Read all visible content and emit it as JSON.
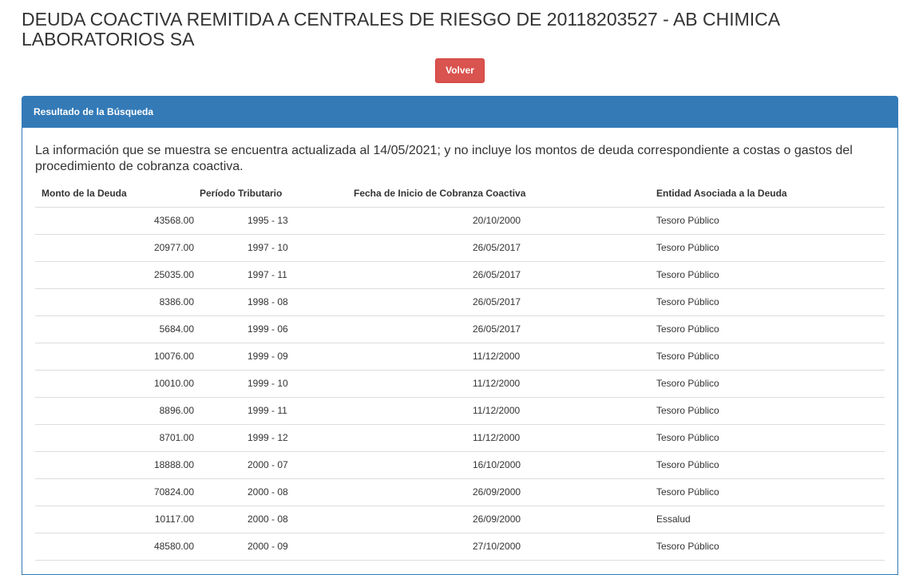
{
  "header": {
    "title": "DEUDA COACTIVA REMITIDA A CENTRALES DE RIESGO DE 20118203527 - AB CHIMICA LABORATORIOS SA",
    "back_label": "Volver"
  },
  "panel": {
    "heading": "Resultado de la Búsqueda",
    "info": "La información que se muestra se encuentra actualizada al 14/05/2021; y no incluye los montos de deuda correspondiente a costas o gastos del procedimiento de cobranza coactiva."
  },
  "table": {
    "columns": [
      "Monto de la Deuda",
      "Período Tributario",
      "Fecha de Inicio de Cobranza Coactiva",
      "Entidad Asociada a la Deuda"
    ],
    "rows": [
      {
        "amount": "43568.00",
        "period": "1995 - 13",
        "date": "20/10/2000",
        "entity": "Tesoro Público"
      },
      {
        "amount": "20977.00",
        "period": "1997 - 10",
        "date": "26/05/2017",
        "entity": "Tesoro Público"
      },
      {
        "amount": "25035.00",
        "period": "1997 - 11",
        "date": "26/05/2017",
        "entity": "Tesoro Público"
      },
      {
        "amount": "8386.00",
        "period": "1998 - 08",
        "date": "26/05/2017",
        "entity": "Tesoro Público"
      },
      {
        "amount": "5684.00",
        "period": "1999 - 06",
        "date": "26/05/2017",
        "entity": "Tesoro Público"
      },
      {
        "amount": "10076.00",
        "period": "1999 - 09",
        "date": "11/12/2000",
        "entity": "Tesoro Público"
      },
      {
        "amount": "10010.00",
        "period": "1999 - 10",
        "date": "11/12/2000",
        "entity": "Tesoro Público"
      },
      {
        "amount": "8896.00",
        "period": "1999 - 11",
        "date": "11/12/2000",
        "entity": "Tesoro Público"
      },
      {
        "amount": "8701.00",
        "period": "1999 - 12",
        "date": "11/12/2000",
        "entity": "Tesoro Público"
      },
      {
        "amount": "18888.00",
        "period": "2000 - 07",
        "date": "16/10/2000",
        "entity": "Tesoro Público"
      },
      {
        "amount": "70824.00",
        "period": "2000 - 08",
        "date": "26/09/2000",
        "entity": "Tesoro Público"
      },
      {
        "amount": "10117.00",
        "period": "2000 - 08",
        "date": "26/09/2000",
        "entity": "Essalud"
      },
      {
        "amount": "48580.00",
        "period": "2000 - 09",
        "date": "27/10/2000",
        "entity": "Tesoro Público"
      }
    ]
  },
  "colors": {
    "panel_primary": "#337ab7",
    "danger_button": "#d9534f"
  }
}
